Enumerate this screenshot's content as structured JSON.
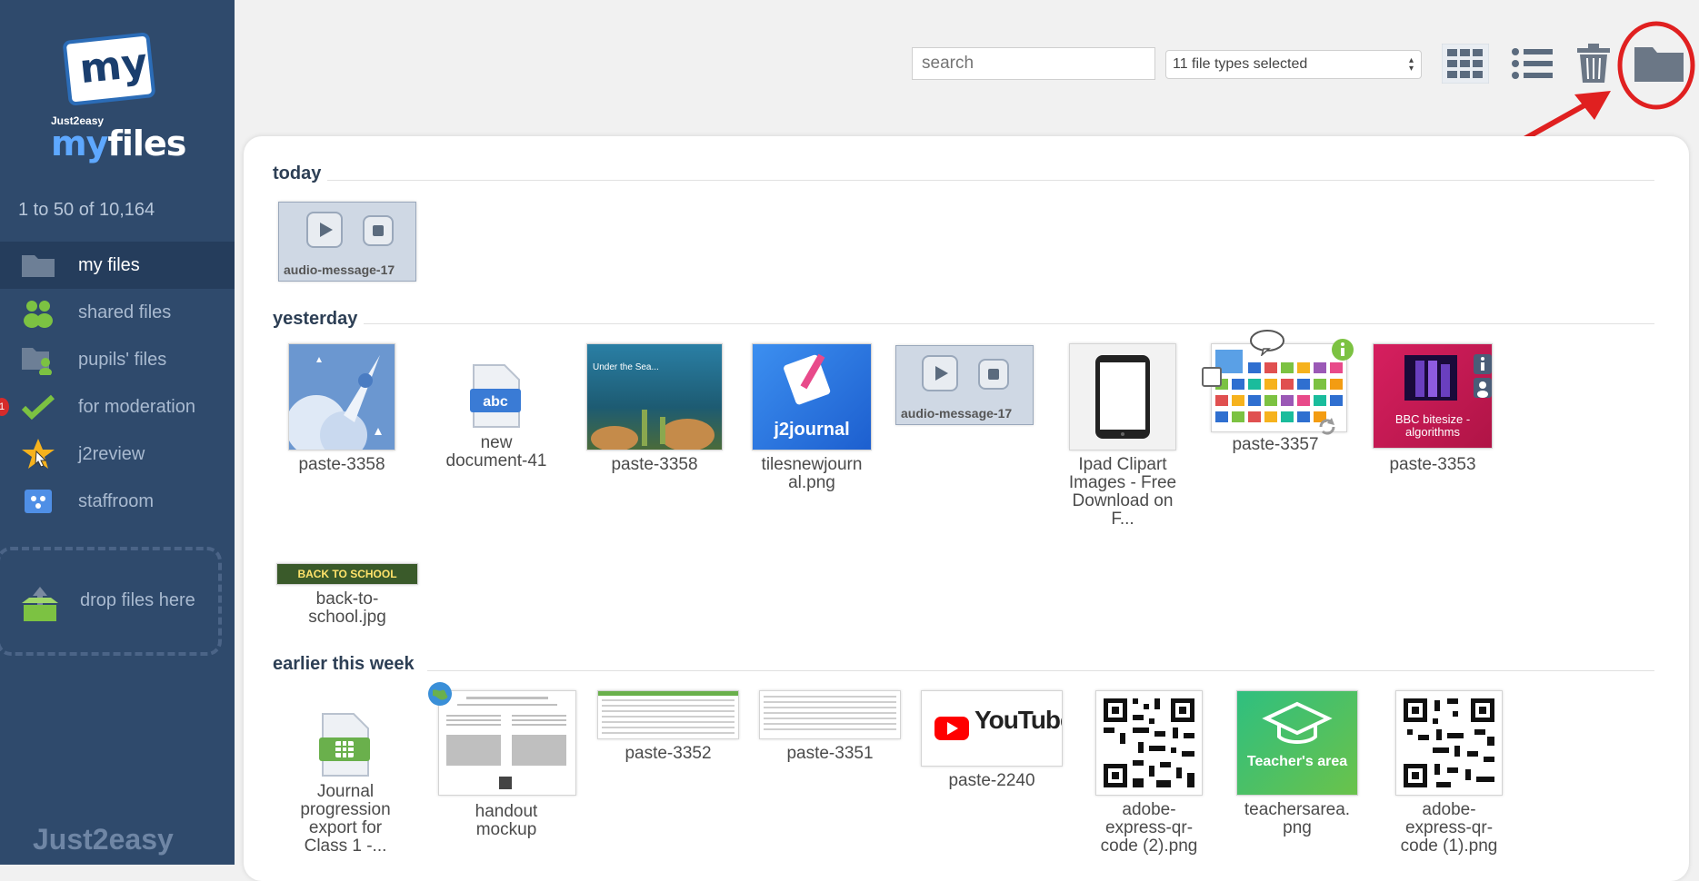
{
  "sidebar": {
    "logo_small": "Just2easy",
    "logo_my": "my",
    "logo_brand_my": "my",
    "logo_brand_files": "files",
    "count": "1 to 50 of 10,164",
    "items": [
      {
        "label": "my files",
        "icon": "folder-icon"
      },
      {
        "label": "shared files",
        "icon": "people-icon"
      },
      {
        "label": "pupils' files",
        "icon": "pupil-folder-icon"
      },
      {
        "label": "for moderation",
        "icon": "check-icon",
        "badge": "1"
      },
      {
        "label": "j2review",
        "icon": "star-cursor-icon"
      },
      {
        "label": "staffroom",
        "icon": "staffroom-icon"
      }
    ],
    "drop_label": "drop files here",
    "footer_brand": "Just2easy"
  },
  "toolbar": {
    "search_placeholder": "search",
    "file_types": "11 file types selected",
    "icons": [
      "grid-view-icon",
      "list-view-icon",
      "trash-icon",
      "folder-icon"
    ]
  },
  "sections": {
    "today": "today",
    "yesterday": "yesterday",
    "earlier": "earlier this week"
  },
  "files": {
    "today": [
      {
        "name": "audio-message-17"
      }
    ],
    "yesterday": [
      {
        "name": "paste-3358"
      },
      {
        "name": "new document-41",
        "line1": "new",
        "line2": "document-41",
        "badge": "abc"
      },
      {
        "name": "paste-3358",
        "caption": "Under the Sea..."
      },
      {
        "name": "tilesnewjournal.png",
        "line1": "tilesnewjourn",
        "line2": "al.png",
        "thumb_text": "j2journal"
      },
      {
        "name": "audio-message-17"
      },
      {
        "name": "Ipad Clipart Images - Free Download on F...",
        "line1": "Ipad Clipart",
        "line2": "Images - Free",
        "line3": "Download on",
        "line4": "F..."
      },
      {
        "name": "paste-3357"
      },
      {
        "name": "paste-3353",
        "thumb_text": "BBC bitesize - algorithms"
      },
      {
        "name": "back-to-school.jpg",
        "line1": "back-to-",
        "line2": "school.jpg",
        "thumb_text": "BACK TO SCHOOL"
      }
    ],
    "earlier": [
      {
        "name": "Journal progression export for Class 1 -...",
        "line1": "Journal",
        "line2": "progression",
        "line3": "export for",
        "line4": "Class 1 -..."
      },
      {
        "name": "handout mockup",
        "line1": "handout",
        "line2": "mockup"
      },
      {
        "name": "paste-3352"
      },
      {
        "name": "paste-3351"
      },
      {
        "name": "paste-2240",
        "thumb_text": "YouTube"
      },
      {
        "name": "adobe-express-qr-code (2).png",
        "line1": "adobe-",
        "line2": "express-qr-",
        "line3": "code (2).png"
      },
      {
        "name": "teachersarea.png",
        "line1": "teachersarea.",
        "line2": "png",
        "thumb_text": "Teacher's area"
      },
      {
        "name": "adobe-express-qr-code (1).png",
        "line1": "adobe-",
        "line2": "express-qr-",
        "line3": "code (1).png"
      }
    ]
  },
  "colors": {
    "sidebar": "#2f4a6c",
    "accent_red": "#e02020",
    "green": "#7cc242"
  }
}
